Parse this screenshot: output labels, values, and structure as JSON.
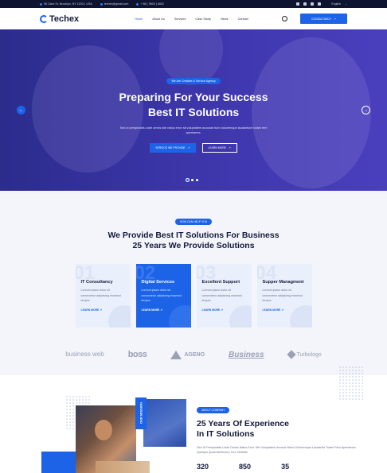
{
  "topbar": {
    "address": "55 Clark St, Brooklyn, NY 11201, USA",
    "email": "techex@gmail.com",
    "phone": "+ 88 ( 9800 ) 6802",
    "language": "English"
  },
  "nav": {
    "brand": "Techex",
    "items": [
      "Home",
      "About Us",
      "Services",
      "Case Study",
      "News",
      "Contact"
    ],
    "cta": "CONSULTANCY"
  },
  "hero": {
    "badge": "We Are Creative & Service Agency",
    "title1": "Preparing For Your Success",
    "title2": "Best IT Solutions",
    "text": "Sed ut perspiciatis unde omnis iste natus error sit voluptatem accusan tium doloremque laudantium totam rem aperiamea.",
    "btn_primary": "SERVICE WE PROVIDE",
    "btn_secondary": "LEARN MORE"
  },
  "services": {
    "badge": "HOW CAN HELP YOU",
    "title1": "We Provide Best IT Solutions For Business",
    "title2": "25 Years We Provide Solutions",
    "cards": [
      {
        "num": "01",
        "title": "IT Consultancy",
        "text": "Loreum ipsum dolor sit consectetur adipiscing eiusmod tempor.",
        "link": "LEARN MORE"
      },
      {
        "num": "02",
        "title": "Digital Services",
        "text": "Loreum ipsum dolor sit consectetur adipiscing eiusmod tempor.",
        "link": "LEARN MORE"
      },
      {
        "num": "03",
        "title": "Excellent Support",
        "text": "Loreum ipsum dolor sit consectetur adipiscing eiusmod tempor.",
        "link": "LEARN MORE"
      },
      {
        "num": "04",
        "title": "Supper Managment",
        "text": "Loreum ipsum dolor sit consectetur adipiscing eiusmod tempor.",
        "link": "LEARN MORE"
      }
    ]
  },
  "brands": [
    "business web",
    "boss",
    "AGENO",
    "Business",
    "Turbologo"
  ],
  "about": {
    "badge": "ABOUT COMPANY",
    "title1": "25 Years Of Experience",
    "title2": "In IT Solutions",
    "mission": "OUR MISSION",
    "text": "Sed Ut Perspiciatis Unde Omnis Natus Error Sitv Voluptatem Accusa Ntium Doloremque Laudantia Totam Rem Aperiamea Queiqsa Quae Abillonven Tore Veritatis",
    "stats": [
      "320",
      "850",
      "35"
    ]
  }
}
